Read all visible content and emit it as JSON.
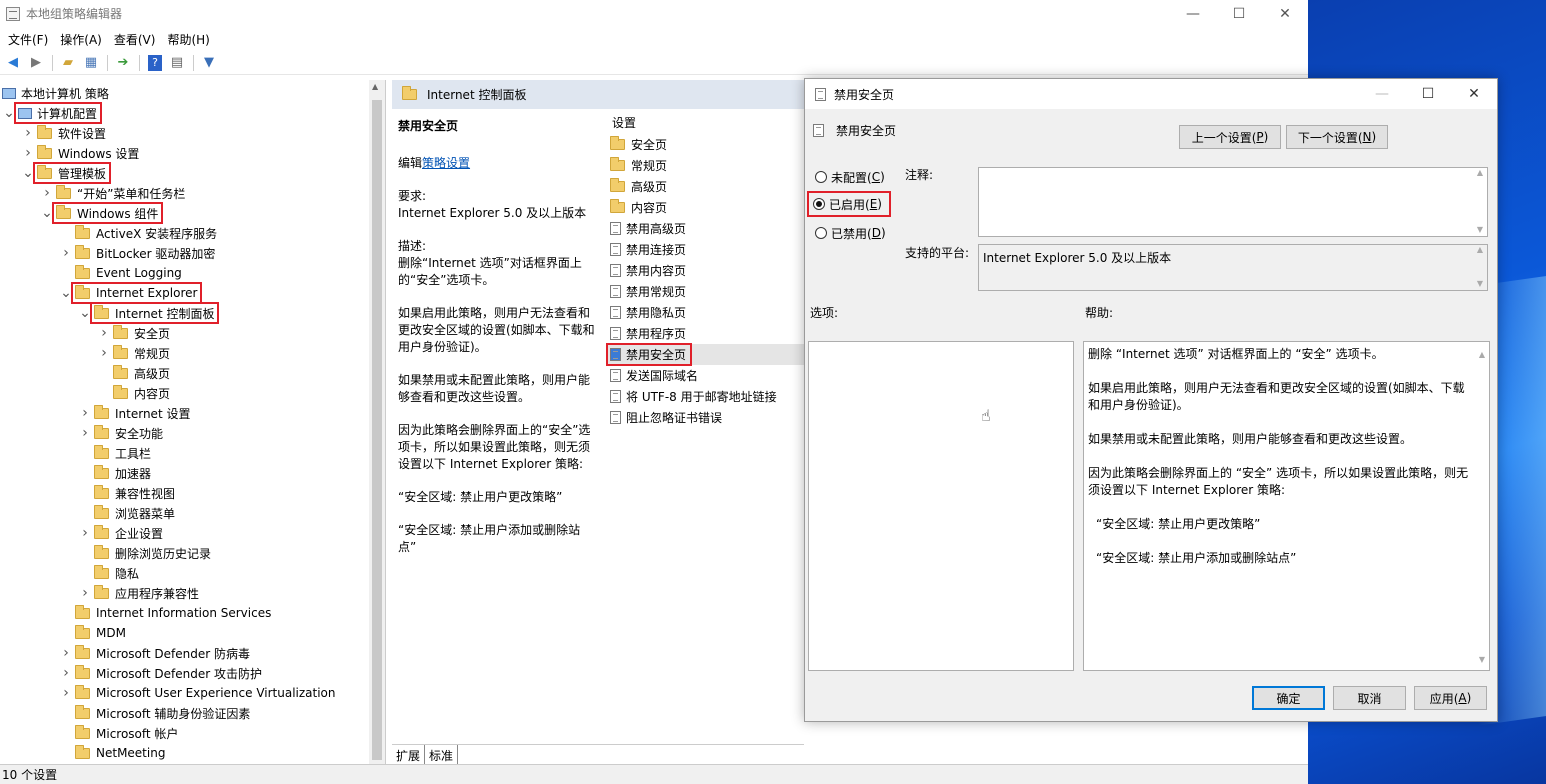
{
  "main_window": {
    "title": "本地组策略编辑器",
    "menu": [
      "文件(F)",
      "操作(A)",
      "查看(V)",
      "帮助(H)"
    ],
    "status": "10 个设置"
  },
  "tree": [
    {
      "label": "本地计算机 策略",
      "depth": 0,
      "exp": "",
      "icon": "computer-icon",
      "hl": false
    },
    {
      "label": "计算机配置",
      "depth": 0,
      "exp": "v",
      "icon": "computer-icon",
      "hl": true
    },
    {
      "label": "软件设置",
      "depth": 1,
      "exp": ">",
      "icon": "folder-icon",
      "hl": false
    },
    {
      "label": "Windows 设置",
      "depth": 1,
      "exp": ">",
      "icon": "folder-icon",
      "hl": false
    },
    {
      "label": "管理模板",
      "depth": 1,
      "exp": "v",
      "icon": "folder-icon",
      "hl": true
    },
    {
      "label": "“开始”菜单和任务栏",
      "depth": 2,
      "exp": ">",
      "icon": "folder-icon",
      "hl": false
    },
    {
      "label": "Windows 组件",
      "depth": 2,
      "exp": "v",
      "icon": "folder-icon",
      "hl": true
    },
    {
      "label": "ActiveX 安装程序服务",
      "depth": 3,
      "exp": "",
      "icon": "folder-icon",
      "hl": false
    },
    {
      "label": "BitLocker 驱动器加密",
      "depth": 3,
      "exp": ">",
      "icon": "folder-icon",
      "hl": false
    },
    {
      "label": "Event Logging",
      "depth": 3,
      "exp": "",
      "icon": "folder-icon",
      "hl": false
    },
    {
      "label": "Internet Explorer",
      "depth": 3,
      "exp": "v",
      "icon": "folder-icon",
      "hl": true
    },
    {
      "label": "Internet 控制面板",
      "depth": 4,
      "exp": "v",
      "icon": "folder-icon",
      "hl": true
    },
    {
      "label": "安全页",
      "depth": 5,
      "exp": ">",
      "icon": "folder-icon",
      "hl": false
    },
    {
      "label": "常规页",
      "depth": 5,
      "exp": ">",
      "icon": "folder-icon",
      "hl": false
    },
    {
      "label": "高级页",
      "depth": 5,
      "exp": "",
      "icon": "folder-icon",
      "hl": false
    },
    {
      "label": "内容页",
      "depth": 5,
      "exp": "",
      "icon": "folder-icon",
      "hl": false
    },
    {
      "label": "Internet 设置",
      "depth": 4,
      "exp": ">",
      "icon": "folder-icon",
      "hl": false
    },
    {
      "label": "安全功能",
      "depth": 4,
      "exp": ">",
      "icon": "folder-icon",
      "hl": false
    },
    {
      "label": "工具栏",
      "depth": 4,
      "exp": "",
      "icon": "folder-icon",
      "hl": false
    },
    {
      "label": "加速器",
      "depth": 4,
      "exp": "",
      "icon": "folder-icon",
      "hl": false
    },
    {
      "label": "兼容性视图",
      "depth": 4,
      "exp": "",
      "icon": "folder-icon",
      "hl": false
    },
    {
      "label": "浏览器菜单",
      "depth": 4,
      "exp": "",
      "icon": "folder-icon",
      "hl": false
    },
    {
      "label": "企业设置",
      "depth": 4,
      "exp": ">",
      "icon": "folder-icon",
      "hl": false
    },
    {
      "label": "删除浏览历史记录",
      "depth": 4,
      "exp": "",
      "icon": "folder-icon",
      "hl": false
    },
    {
      "label": "隐私",
      "depth": 4,
      "exp": "",
      "icon": "folder-icon",
      "hl": false
    },
    {
      "label": "应用程序兼容性",
      "depth": 4,
      "exp": ">",
      "icon": "folder-icon",
      "hl": false
    },
    {
      "label": "Internet Information Services",
      "depth": 3,
      "exp": "",
      "icon": "folder-icon",
      "hl": false
    },
    {
      "label": "MDM",
      "depth": 3,
      "exp": "",
      "icon": "folder-icon",
      "hl": false
    },
    {
      "label": "Microsoft Defender 防病毒",
      "depth": 3,
      "exp": ">",
      "icon": "folder-icon",
      "hl": false
    },
    {
      "label": "Microsoft Defender 攻击防护",
      "depth": 3,
      "exp": ">",
      "icon": "folder-icon",
      "hl": false
    },
    {
      "label": "Microsoft User Experience Virtualization",
      "depth": 3,
      "exp": ">",
      "icon": "folder-icon",
      "hl": false
    },
    {
      "label": "Microsoft 辅助身份验证因素",
      "depth": 3,
      "exp": "",
      "icon": "folder-icon",
      "hl": false
    },
    {
      "label": "Microsoft 帐户",
      "depth": 3,
      "exp": "",
      "icon": "folder-icon",
      "hl": false
    },
    {
      "label": "NetMeeting",
      "depth": 3,
      "exp": "",
      "icon": "folder-icon",
      "hl": false
    }
  ],
  "desc": {
    "header": "Internet 控制面板",
    "policy_name": "禁用安全页",
    "edit_prefix": "编辑",
    "edit_link": "策略设置",
    "req_label": "要求:",
    "req_value": "Internet Explorer 5.0 及以上版本",
    "desc_label": "描述:",
    "desc_1": "删除“Internet 选项”对话框界面上的“安全”选项卡。",
    "desc_2": "如果启用此策略，则用户无法查看和更改安全区域的设置(如脚本、下载和用户身份验证)。",
    "desc_3": "如果禁用或未配置此策略，则用户能够查看和更改这些设置。",
    "desc_4": "因为此策略会删除界面上的“安全”选项卡，所以如果设置此策略，则无须设置以下 Internet Explorer 策略:",
    "desc_5": "“安全区域: 禁止用户更改策略”",
    "desc_6": "“安全区域: 禁止用户添加或删除站点”",
    "settings_col": "设置",
    "tab_ext": "扩展",
    "tab_std": "标准"
  },
  "settings": [
    {
      "label": "安全页",
      "type": "folder"
    },
    {
      "label": "常规页",
      "type": "folder"
    },
    {
      "label": "高级页",
      "type": "folder"
    },
    {
      "label": "内容页",
      "type": "folder"
    },
    {
      "label": "禁用高级页",
      "type": "policy"
    },
    {
      "label": "禁用连接页",
      "type": "policy"
    },
    {
      "label": "禁用内容页",
      "type": "policy"
    },
    {
      "label": "禁用常规页",
      "type": "policy"
    },
    {
      "label": "禁用隐私页",
      "type": "policy"
    },
    {
      "label": "禁用程序页",
      "type": "policy"
    },
    {
      "label": "禁用安全页",
      "type": "policy",
      "selected": true
    },
    {
      "label": "发送国际域名",
      "type": "policy"
    },
    {
      "label": "将 UTF-8 用于邮寄地址链接",
      "type": "policy"
    },
    {
      "label": "阻止忽略证书错误",
      "type": "policy"
    }
  ],
  "dialog": {
    "title": "禁用安全页",
    "setting_name": "禁用安全页",
    "prev_pre": "上一个设置(",
    "prev_key": "P",
    "prev_post": ")",
    "next_pre": "下一个设置(",
    "next_key": "N",
    "next_post": ")",
    "radio_nc_pre": "未配置(",
    "radio_nc_key": "C",
    "radio_nc_post": ")",
    "radio_en_pre": "已启用(",
    "radio_en_key": "E",
    "radio_en_post": ")",
    "radio_dis_pre": "已禁用(",
    "radio_dis_key": "D",
    "radio_dis_post": ")",
    "selected_state": "已启用",
    "comment_label": "注释:",
    "platform_label": "支持的平台:",
    "platform_value": "Internet Explorer 5.0 及以上版本",
    "options_label": "选项:",
    "help_label": "帮助:",
    "help_1": "删除 “Internet 选项” 对话框界面上的 “安全” 选项卡。",
    "help_2": "如果启用此策略，则用户无法查看和更改安全区域的设置(如脚本、下载和用户身份验证)。",
    "help_3": "如果禁用或未配置此策略，则用户能够查看和更改这些设置。",
    "help_4": "因为此策略会删除界面上的 “安全” 选项卡，所以如果设置此策略，则无须设置以下 Internet Explorer 策略:",
    "help_5": "“安全区域: 禁止用户更改策略”",
    "help_6": "“安全区域: 禁止用户添加或删除站点”",
    "ok": "确定",
    "cancel": "取消",
    "apply_pre": "应用(",
    "apply_key": "A",
    "apply_post": ")"
  },
  "colors": {
    "highlight": "#e0202a",
    "accent": "#0078d7"
  }
}
